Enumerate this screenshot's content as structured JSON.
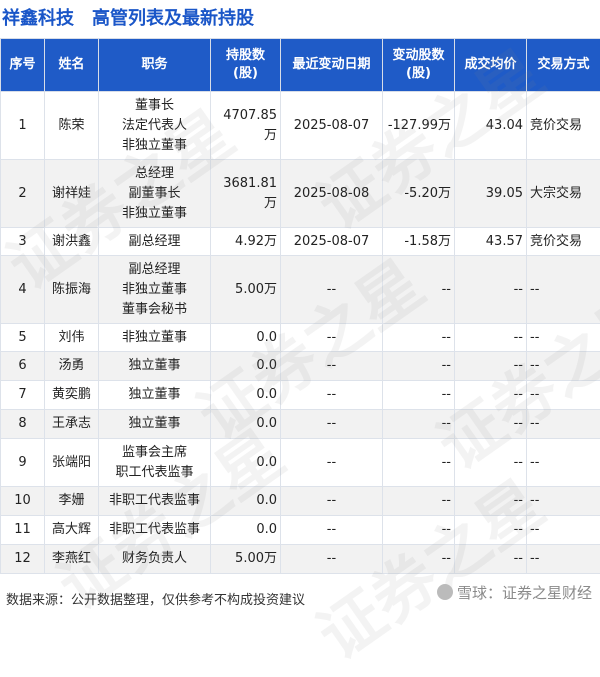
{
  "header": {
    "company": "祥鑫科技",
    "title": "高管列表及最新持股"
  },
  "columns": [
    "序号",
    "姓名",
    "职务",
    "持股数\n(股)",
    "最近变动日期",
    "变动股数\n(股)",
    "成交均价",
    "交易方式"
  ],
  "rows": [
    {
      "no": "1",
      "name": "陈荣",
      "roles": [
        "董事长",
        "法定代表人",
        "非独立董事"
      ],
      "shares": "4707.85万",
      "date": "2025-08-07",
      "change": "-127.99万",
      "price": "43.04",
      "method": "竞价交易"
    },
    {
      "no": "2",
      "name": "谢祥娃",
      "roles": [
        "总经理",
        "副董事长",
        "非独立董事"
      ],
      "shares": "3681.81万",
      "date": "2025-08-08",
      "change": "-5.20万",
      "price": "39.05",
      "method": "大宗交易"
    },
    {
      "no": "3",
      "name": "谢洪鑫",
      "roles": [
        "副总经理"
      ],
      "shares": "4.92万",
      "date": "2025-08-07",
      "change": "-1.58万",
      "price": "43.57",
      "method": "竞价交易"
    },
    {
      "no": "4",
      "name": "陈振海",
      "roles": [
        "副总经理",
        "非独立董事",
        "董事会秘书"
      ],
      "shares": "5.00万",
      "date": "--",
      "change": "--",
      "price": "--",
      "method": "--"
    },
    {
      "no": "5",
      "name": "刘伟",
      "roles": [
        "非独立董事"
      ],
      "shares": "0.0",
      "date": "--",
      "change": "--",
      "price": "--",
      "method": "--"
    },
    {
      "no": "6",
      "name": "汤勇",
      "roles": [
        "独立董事"
      ],
      "shares": "0.0",
      "date": "--",
      "change": "--",
      "price": "--",
      "method": "--"
    },
    {
      "no": "7",
      "name": "黄奕鹏",
      "roles": [
        "独立董事"
      ],
      "shares": "0.0",
      "date": "--",
      "change": "--",
      "price": "--",
      "method": "--"
    },
    {
      "no": "8",
      "name": "王承志",
      "roles": [
        "独立董事"
      ],
      "shares": "0.0",
      "date": "--",
      "change": "--",
      "price": "--",
      "method": "--"
    },
    {
      "no": "9",
      "name": "张端阳",
      "roles": [
        "监事会主席",
        "职工代表监事"
      ],
      "shares": "0.0",
      "date": "--",
      "change": "--",
      "price": "--",
      "method": "--"
    },
    {
      "no": "10",
      "name": "李姗",
      "roles": [
        "非职工代表监事"
      ],
      "shares": "0.0",
      "date": "--",
      "change": "--",
      "price": "--",
      "method": "--"
    },
    {
      "no": "11",
      "name": "高大辉",
      "roles": [
        "非职工代表监事"
      ],
      "shares": "0.0",
      "date": "--",
      "change": "--",
      "price": "--",
      "method": "--"
    },
    {
      "no": "12",
      "name": "李燕红",
      "roles": [
        "财务负责人"
      ],
      "shares": "5.00万",
      "date": "--",
      "change": "--",
      "price": "--",
      "method": "--"
    }
  ],
  "watermark": "证券之星",
  "footer": {
    "source": "数据来源：公开数据整理，仅供参考不构成投资建议"
  },
  "brand": {
    "text": "雪球：证券之星财经",
    "icon": "snowball-icon"
  },
  "colors": {
    "header_bg": "#1f5bc7",
    "title": "#1a56c8",
    "negative": "#1a9a2c",
    "alt_row": "#f2f2f2"
  }
}
